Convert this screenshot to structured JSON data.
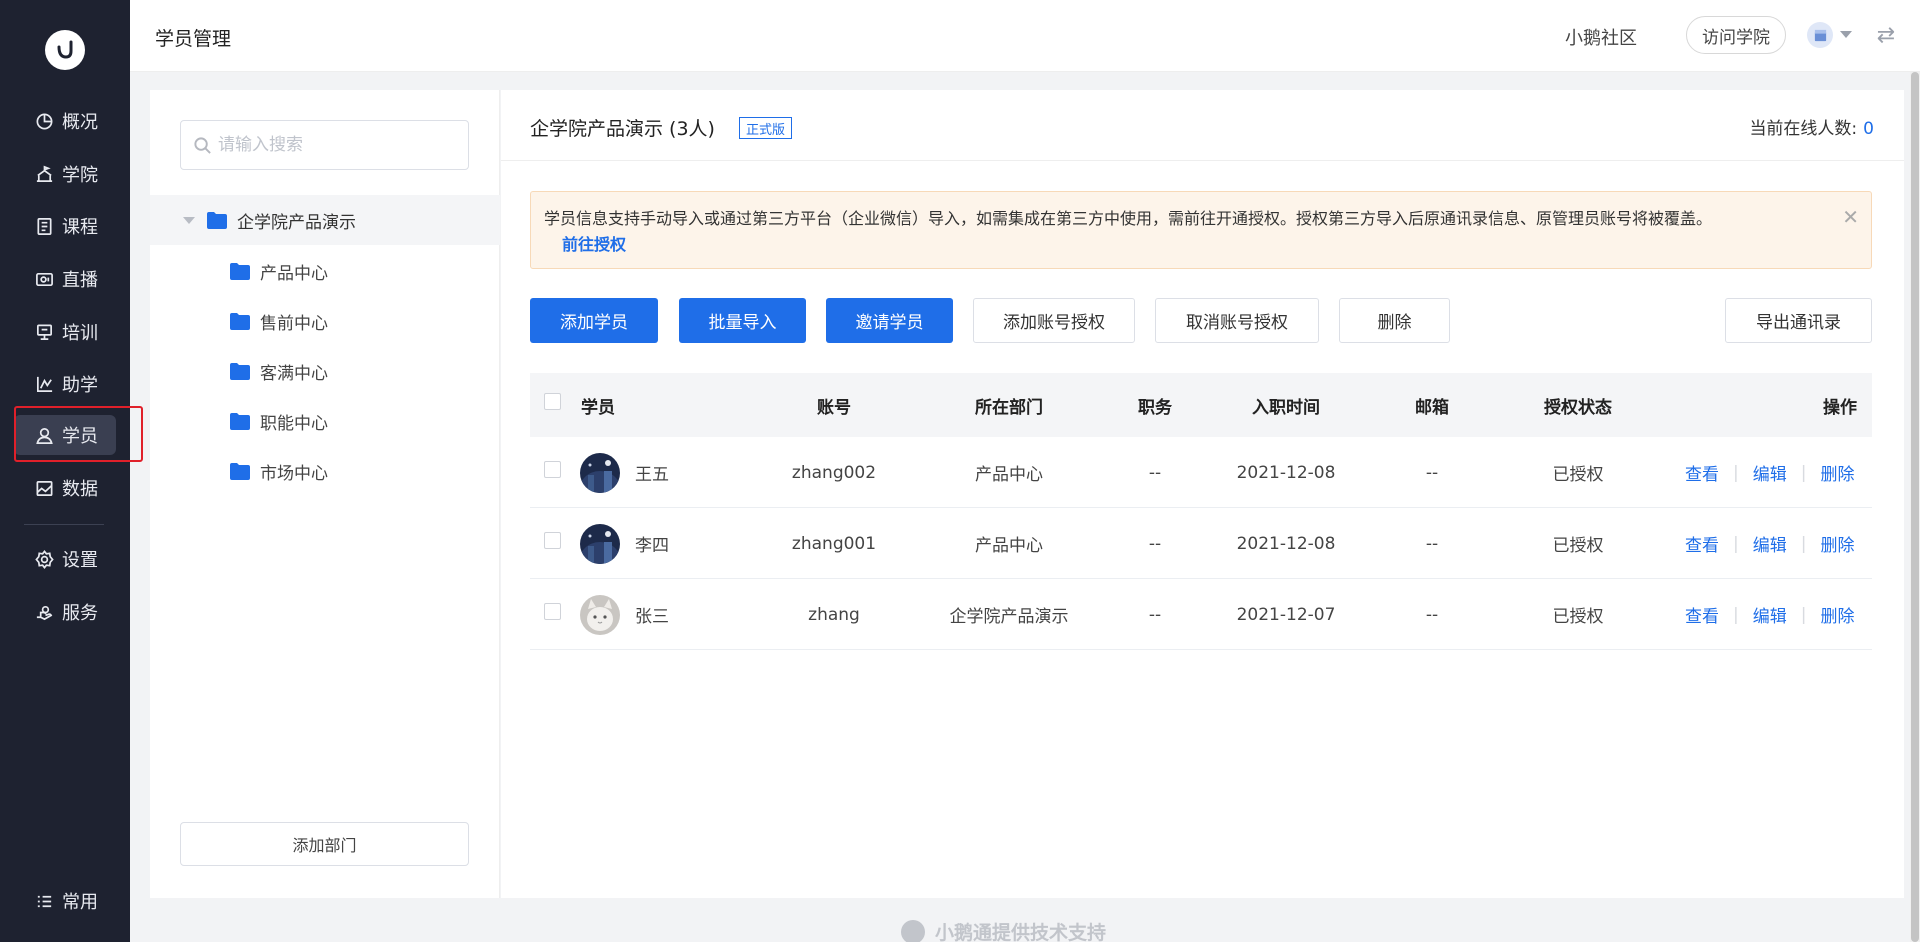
{
  "nav": {
    "items": [
      {
        "label": "概况",
        "icon": "overview-icon"
      },
      {
        "label": "学院",
        "icon": "academy-icon"
      },
      {
        "label": "课程",
        "icon": "course-icon"
      },
      {
        "label": "直播",
        "icon": "live-icon"
      },
      {
        "label": "培训",
        "icon": "training-icon"
      },
      {
        "label": "助学",
        "icon": "study-aid-icon"
      },
      {
        "label": "学员",
        "icon": "student-icon",
        "active": true
      },
      {
        "label": "数据",
        "icon": "data-icon"
      },
      {
        "label": "设置",
        "icon": "settings-icon"
      },
      {
        "label": "服务",
        "icon": "service-icon"
      },
      {
        "label": "常用",
        "icon": "menu-icon"
      }
    ]
  },
  "header": {
    "title": "学员管理",
    "community": "小鹅社区",
    "visit_button": "访问学院"
  },
  "dept": {
    "search_placeholder": "请输入搜索",
    "root": "企学院产品演示",
    "children": [
      "产品中心",
      "售前中心",
      "客满中心",
      "职能中心",
      "市场中心"
    ],
    "add_button": "添加部门"
  },
  "main": {
    "org_title": "企学院产品演示 (3人)",
    "badge": "正式版",
    "online_label": "当前在线人数:",
    "online_count": "0",
    "notice_text": "学员信息支持手动导入或通过第三方平台（企业微信）导入，如需集成在第三方中使用，需前往开通授权。授权第三方导入后原通讯录信息、原管理员账号将被覆盖。",
    "notice_link": "前往授权",
    "buttons": {
      "add_student": "添加学员",
      "bulk_import": "批量导入",
      "invite": "邀请学员",
      "add_auth": "添加账号授权",
      "cancel_auth": "取消账号授权",
      "delete": "删除",
      "export": "导出通讯录"
    },
    "table": {
      "headers": {
        "student": "学员",
        "account": "账号",
        "dept": "所在部门",
        "position": "职务",
        "join_date": "入职时间",
        "email": "邮箱",
        "auth_status": "授权状态",
        "actions": "操作"
      },
      "rows": [
        {
          "name": "王五",
          "account": "zhang002",
          "dept": "产品中心",
          "position": "--",
          "join_date": "2021-12-08",
          "email": "--",
          "auth_status": "已授权"
        },
        {
          "name": "李四",
          "account": "zhang001",
          "dept": "产品中心",
          "position": "--",
          "join_date": "2021-12-08",
          "email": "--",
          "auth_status": "已授权"
        },
        {
          "name": "张三",
          "account": "zhang",
          "dept": "企学院产品演示",
          "position": "--",
          "join_date": "2021-12-07",
          "email": "--",
          "auth_status": "已授权"
        }
      ],
      "action_labels": {
        "view": "查看",
        "edit": "编辑",
        "delete": "删除"
      }
    }
  },
  "footer": {
    "text": "小鹅通提供技术支持"
  },
  "colors": {
    "primary": "#1f6ee8",
    "sidebar": "#1e2230",
    "notice_bg": "#fdf4ea",
    "highlight_box": "#e0202a"
  }
}
